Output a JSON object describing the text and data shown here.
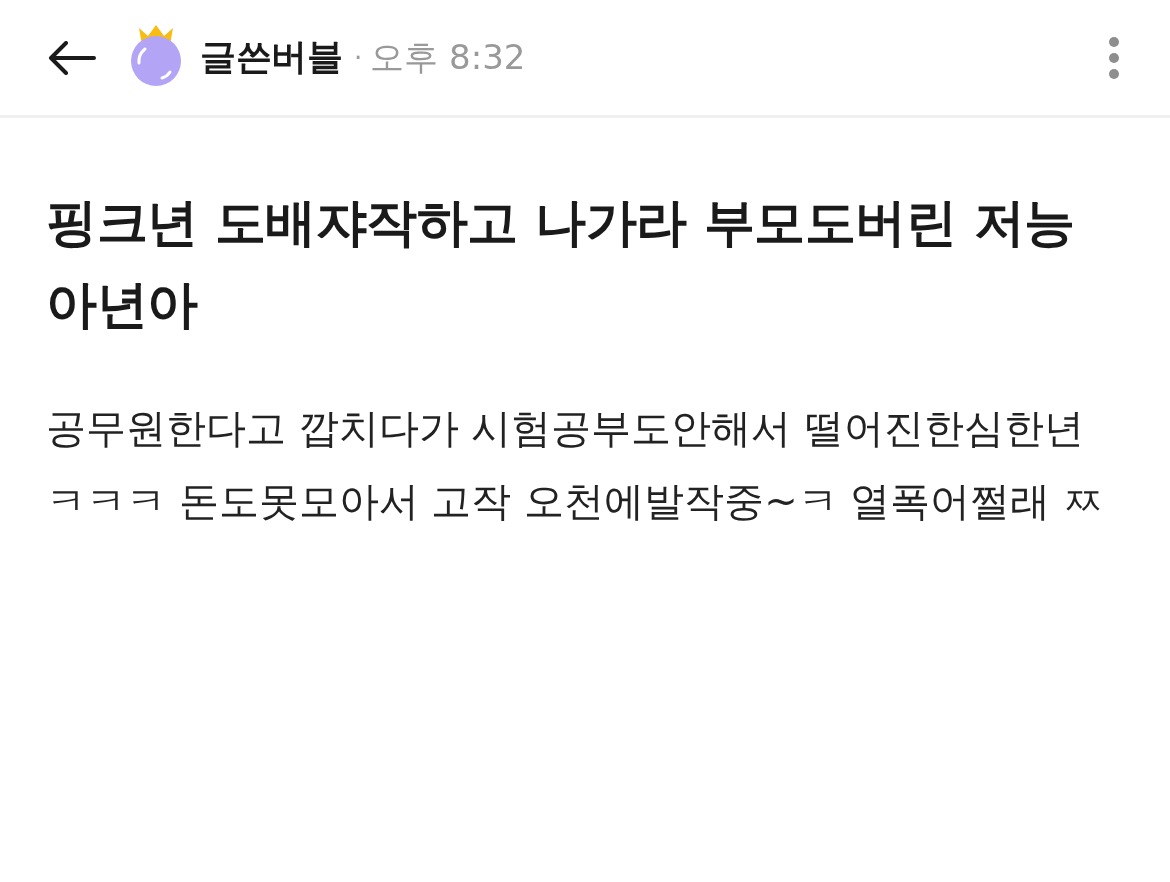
{
  "header": {
    "author": "글쓴버블",
    "separator": "·",
    "time": "오후 8:32"
  },
  "post": {
    "title": "핑크년 도배쟈작하고 나가라 부모도버린 저능아년아",
    "body": "공무원한다고 깝치다가 시험공부도안해서 떨어진한심한년 ㅋㅋㅋ 돈도못모아서 고작 오천에발작중~ㅋ 열폭어쩔래 ㅉ"
  }
}
